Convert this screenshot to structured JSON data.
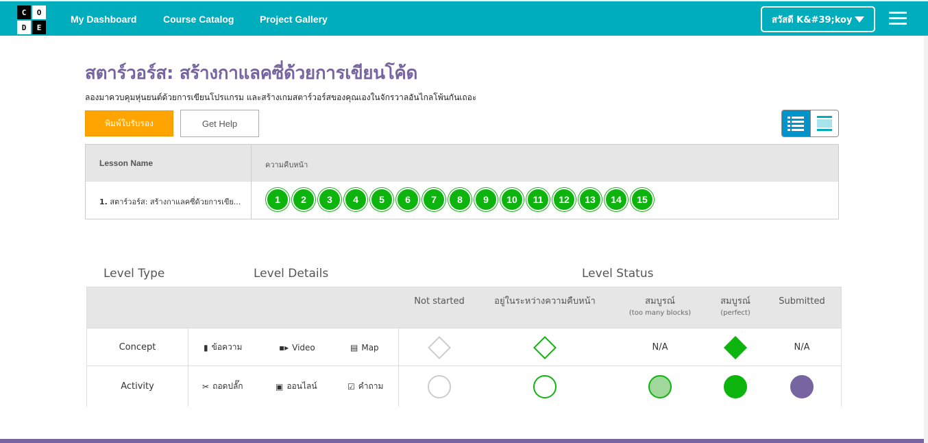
{
  "logo": {
    "letters": [
      "C",
      "O",
      "D",
      "E"
    ]
  },
  "nav": {
    "dashboard": "My Dashboard",
    "catalog": "Course Catalog",
    "gallery": "Project Gallery"
  },
  "user": {
    "greeting": "สวัสดี K&#39;koy"
  },
  "page": {
    "title": "สตาร์วอร์ส: สร้างกาแลคซี่ด้วยการเขียนโค้ด",
    "description": "ลองมาควบคุมหุ่นยนต์ด้วยการเขียนโปรแกรม และสร้างเกมสตาร์วอร์สของคุณเองในจักรวาลอันไกลโพ้นกันเถอะ",
    "print_button": "พิมพ์ใบรับรอง",
    "help_button": "Get Help"
  },
  "progress_table": {
    "col_lesson": "Lesson Name",
    "col_progress": "ความคืบหน้า",
    "lesson_number": "1.",
    "lesson_name": "สตาร์วอร์ส: สร้างกาแลคซี่ด้วยการเขีย...",
    "levels": [
      "1",
      "2",
      "3",
      "4",
      "5",
      "6",
      "7",
      "8",
      "9",
      "10",
      "11",
      "12",
      "13",
      "14",
      "15"
    ]
  },
  "key": {
    "level_type": "Level Type",
    "level_details": "Level Details",
    "level_status": "Level Status",
    "status_headers": {
      "not_started": "Not started",
      "in_progress": "อยู่ในระหว่างความคืบหน้า",
      "complete_too_many": "สมบูรณ์",
      "complete_too_many_sub": "(too many blocks)",
      "complete_perfect": "สมบูรณ์",
      "complete_perfect_sub": "(perfect)",
      "submitted": "Submitted"
    },
    "rows": {
      "concept": {
        "type": "Concept",
        "detail_text": "ข้อความ",
        "detail_video": "Video",
        "detail_map": "Map",
        "too_many": "N/A",
        "submitted": "N/A"
      },
      "activity": {
        "type": "Activity",
        "detail_unplugged": "ถอดปลั๊ก",
        "detail_online": "ออนไลน์",
        "detail_question": "คำถาม"
      }
    },
    "colors": {
      "complete": "#0eb40e",
      "too_many": "#a0d79a",
      "submitted": "#7665a0",
      "not_started": "#cccccc"
    }
  }
}
